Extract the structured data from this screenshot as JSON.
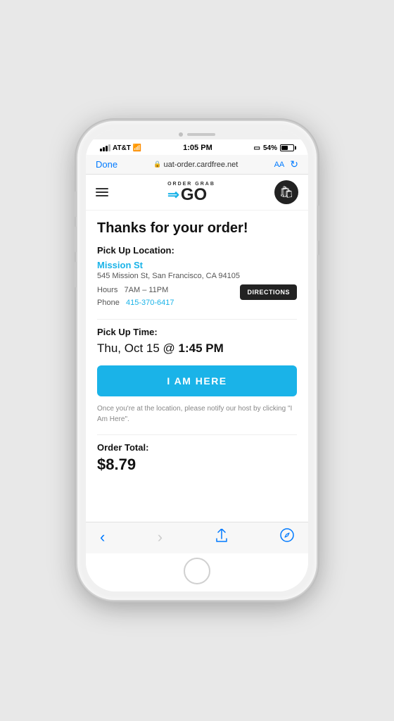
{
  "phone": {
    "status_bar": {
      "carrier": "AT&T",
      "wifi": true,
      "time": "1:05 PM",
      "screen_mirroring": true,
      "battery_percent": "54%"
    },
    "browser_bar": {
      "done_label": "Done",
      "url": "uat-order.cardfree.net",
      "aa_label": "AA",
      "reload_icon": "↻"
    },
    "browser_nav": {
      "back_label": "‹",
      "forward_label": "›",
      "share_label": "⬆",
      "compass_label": "⊕"
    }
  },
  "app": {
    "logo": {
      "top_text": "ORDER GRAB",
      "go_text": "GO"
    },
    "header": {
      "thanks_heading": "Thanks for your order!"
    },
    "pickup_location": {
      "section_label": "Pick Up Location:",
      "name": "Mission St",
      "address": "545 Mission St, San Francisco, CA 94105",
      "hours_label": "Hours",
      "hours_value": "7AM – 11PM",
      "phone_label": "Phone",
      "phone_value": "415-370-6417",
      "directions_label": "DIRECTIONS"
    },
    "pickup_time": {
      "section_label": "Pick Up Time:",
      "value_prefix": "Thu, Oct 15 @ ",
      "value_bold": "1:45 PM"
    },
    "i_am_here": {
      "button_label": "I AM HERE",
      "note": "Once you're at the location, please notify our host by clicking \"I Am Here\"."
    },
    "order_total": {
      "label": "Order Total:",
      "value": "$8.79"
    }
  }
}
